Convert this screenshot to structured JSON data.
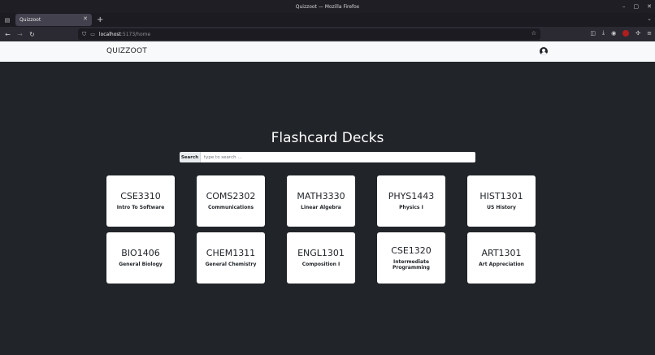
{
  "window": {
    "title": "Quizzoot — Mozilla Firefox",
    "controls": [
      "–",
      "▢",
      "✕"
    ]
  },
  "browser": {
    "tab_title": "Quizzoot",
    "url_host": "localhost",
    "url_path": ":5173/home"
  },
  "app": {
    "brand": "QUIZZOOT",
    "heading": "Flashcard Decks",
    "search": {
      "label": "Search",
      "placeholder": "type to search ..."
    },
    "decks": [
      {
        "code": "CSE3310",
        "name": "Intro To Software"
      },
      {
        "code": "COMS2302",
        "name": "Communications"
      },
      {
        "code": "MATH3330",
        "name": "Linear Algebra"
      },
      {
        "code": "PHYS1443",
        "name": "Physics I"
      },
      {
        "code": "HIST1301",
        "name": "US History"
      },
      {
        "code": "BIO1406",
        "name": "General Biology"
      },
      {
        "code": "CHEM1311",
        "name": "General Chemistry"
      },
      {
        "code": "ENGL1301",
        "name": "Composition I"
      },
      {
        "code": "CSE1320",
        "name": "Intermediate Programming"
      },
      {
        "code": "ART1301",
        "name": "Art Appreciation"
      }
    ]
  },
  "colors": {
    "page_bg": "#212529",
    "navbar_bg": "#f8f9fa",
    "card_bg": "#ffffff"
  }
}
